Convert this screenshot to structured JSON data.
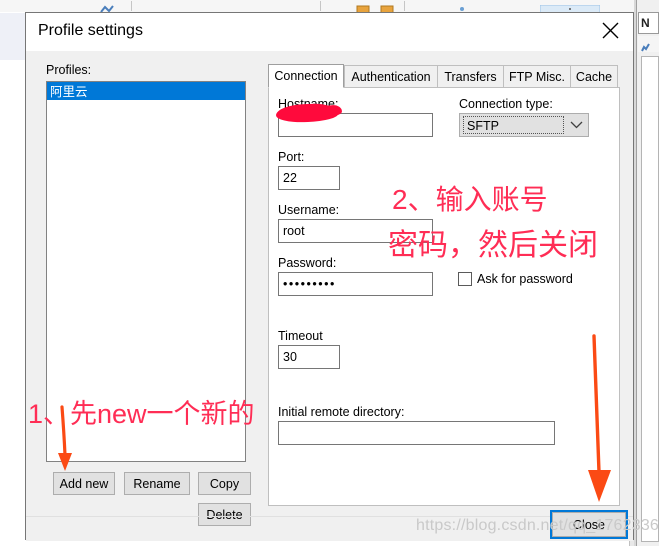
{
  "dialog": {
    "title": "Profile settings",
    "close_icon": "close-x-icon"
  },
  "profiles": {
    "label": "Profiles:",
    "items": [
      {
        "name": "阿里云",
        "selected": true
      }
    ],
    "buttons": {
      "add_new": "Add new",
      "rename": "Rename",
      "copy": "Copy",
      "delete": "Delete"
    }
  },
  "tabs": [
    {
      "label": "Connection",
      "active": true
    },
    {
      "label": "Authentication",
      "active": false
    },
    {
      "label": "Transfers",
      "active": false
    },
    {
      "label": "FTP Misc.",
      "active": false
    },
    {
      "label": "Cache",
      "active": false
    }
  ],
  "connection": {
    "hostname": {
      "label": "Hostname:",
      "value": "",
      "redacted": true
    },
    "connection_type": {
      "label": "Connection type:",
      "value": "SFTP",
      "arrow_icon": "chevron-down-icon"
    },
    "port": {
      "label": "Port:",
      "value": "22"
    },
    "username": {
      "label": "Username:",
      "value": "root"
    },
    "password": {
      "label": "Password:",
      "value": "•••••••••"
    },
    "ask_for_password": {
      "label": "Ask for password",
      "checked": false
    },
    "timeout": {
      "label": "Timeout",
      "value": "30"
    },
    "initial_remote_directory": {
      "label": "Initial remote directory:",
      "value": ""
    }
  },
  "footer": {
    "close": "Close"
  },
  "annotations": [
    {
      "id": "step-1",
      "text": "1、先new一个新的",
      "color": "#ff2d55"
    },
    {
      "id": "step-2a",
      "text": "2、输入账号",
      "color": "#ff2d55"
    },
    {
      "id": "step-2b",
      "text": "密码，然后关闭",
      "color": "#ff2d55"
    }
  ],
  "arrows": {
    "color": "#fb4a14"
  },
  "watermark": {
    "text": "https://blog.csdn.net/qq_17623363"
  },
  "background": {
    "right_window_label": "N"
  }
}
